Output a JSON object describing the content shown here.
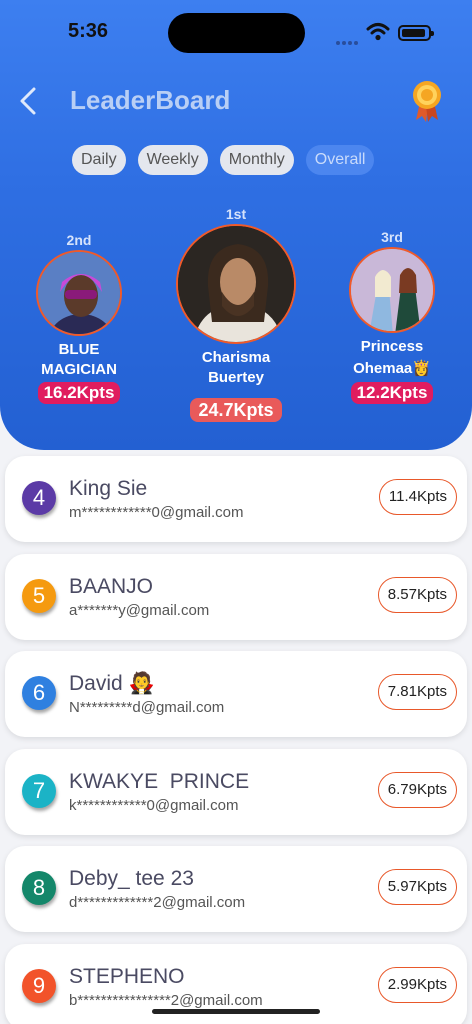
{
  "status": {
    "time": "5:36"
  },
  "header": {
    "title": "LeaderBoard",
    "filters": [
      "Daily",
      "Weekly",
      "Monthly",
      "Overall"
    ],
    "active_filter": "Overall"
  },
  "podium": {
    "first": {
      "rank": "1st",
      "name_line1": "Charisma",
      "name_line2": "Buertey",
      "points": "24.7Kpts"
    },
    "second": {
      "rank": "2nd",
      "name_line1": "BLUE",
      "name_line2": "MAGICIAN",
      "points": "16.2Kpts"
    },
    "third": {
      "rank": "3rd",
      "name_line1": "Princess",
      "name_line2": "Ohemaa👸",
      "points": "12.2Kpts"
    }
  },
  "leaderboard": [
    {
      "rank": "4",
      "name": "King Sie",
      "email": "m************0@gmail.com",
      "points": "11.4Kpts",
      "color": "#5b3aa6"
    },
    {
      "rank": "5",
      "name": "BAANJO",
      "email": "a*******y@gmail.com",
      "points": "8.57Kpts",
      "color": "#f59a10"
    },
    {
      "rank": "6",
      "name": "David 🧛",
      "email": "N*********d@gmail.com",
      "points": "7.81Kpts",
      "color": "#2f80e0"
    },
    {
      "rank": "7",
      "name": "KWAKYE  PRINCE",
      "email": "k************0@gmail.com",
      "points": "6.79Kpts",
      "color": "#1bb3c6"
    },
    {
      "rank": "8",
      "name": "Deby_ tee 23",
      "email": "d*************2@gmail.com",
      "points": "5.97Kpts",
      "color": "#14876a"
    },
    {
      "rank": "9",
      "name": "STEPHENO",
      "email": "b****************2@gmail.com",
      "points": "2.99Kpts",
      "color": "#f2532a"
    }
  ],
  "colors": {
    "header_blue": "#2f6fe3",
    "accent_orange": "#e8582a",
    "points_pink": "#e01c5f"
  }
}
